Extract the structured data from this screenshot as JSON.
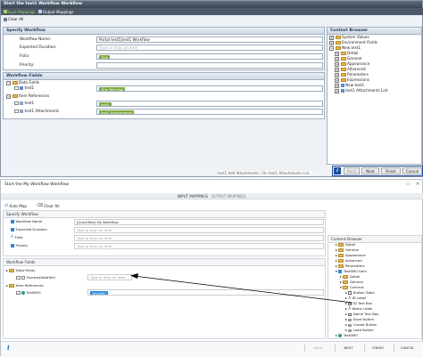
{
  "old": {
    "title": "Start the test1 Workflow Workflow",
    "tabs": [
      "Input Mappings",
      "Output Mappings"
    ],
    "clear_all": "Clear All",
    "specify_header": "Specify Workflow",
    "fields": [
      {
        "label": "Workflow Name:",
        "value": "Portal test1|test1 Workflow"
      },
      {
        "label": "Expected Duration:",
        "value": "Type or drop an item"
      },
      {
        "label": "Folio:",
        "value": "Title"
      },
      {
        "label": "Priority:",
        "value": ""
      }
    ],
    "wf_fields_header": "Workflow Fields",
    "data_fields": "Data Fields",
    "test1": "test1",
    "title_text_box": "Title Text Box",
    "item_references": "Item References",
    "test1_attachments": "test1 Attachments",
    "context_header": "Context Browser",
    "context_items": [
      "System Values",
      "Environment Fields",
      "New test1",
      "Detail",
      "General",
      "Appearance",
      "Advanced",
      "Parameters",
      "Expressions",
      "New test1",
      "test1 Attachments List"
    ],
    "buttons": {
      "back": "Back",
      "next": "Next",
      "finish": "Finish",
      "cancel": "Cancel"
    },
    "status_text": "test1 Add Attachments | On test1 Attachments List..."
  },
  "new": {
    "title": "Start the My Workflow Workflow",
    "tabs": [
      "INPUT MAPPINGS",
      "OUTPUT MAPPINGS"
    ],
    "auto_map": "Auto Map",
    "clear_all": "Clear All",
    "specify_header": "Specify Workflow",
    "fields": [
      {
        "label": "Workflow Name",
        "value": "[QuickTest] My Workflow"
      },
      {
        "label": "Expected Duration",
        "value": "Type or drop an item"
      },
      {
        "label": "Folio",
        "value": "Type or drop an item"
      },
      {
        "label": "Priority",
        "value": "Type or drop an item"
      }
    ],
    "wf_fields_header": "Workflow Fields",
    "data_fields": "Data Fields",
    "process_data_field": "ProcessDataField",
    "drop_placeholder": "Type or drop an item",
    "item_references": "Item References",
    "test_smo": "TestSMO",
    "test_smo_tag": "TestSMO",
    "context_header": "Content Browser",
    "context_items": [
      "Detail",
      "General",
      "Appearance",
      "Advanced",
      "Parameters",
      "TestSMO Item",
      "Detail",
      "General",
      "Controls",
      "Button Table",
      "ID Label",
      "ID Text Box",
      "Name Label",
      "Name Text Box",
      "Save Button",
      "Create Button",
      "Load Button",
      "TestSMO"
    ],
    "buttons": {
      "back": "BACK",
      "next": "NEXT",
      "finish": "FINISH",
      "cancel": "CANCEL"
    },
    "colors": {
      "old_title_bg": "#4a5563",
      "old_section_bg": "#d7dfe8",
      "accent_blue": "#1e4f9a",
      "tag_green": "#7aa83a",
      "tag_blue": "#2b88d8",
      "info": "#1f6fc4"
    }
  }
}
